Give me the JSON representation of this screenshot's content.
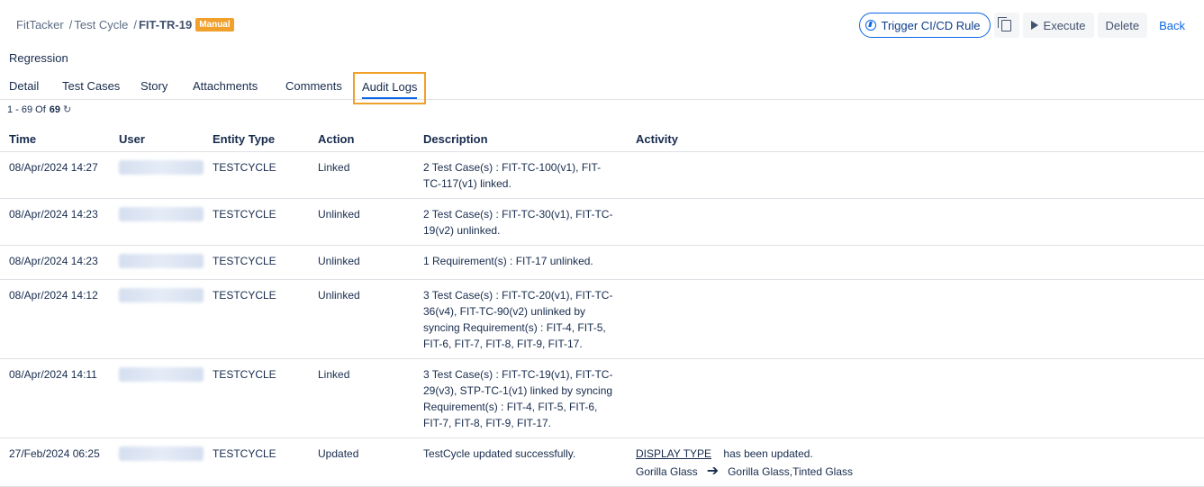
{
  "breadcrumb": {
    "project": "FitTacker",
    "section": "Test Cycle",
    "current": "FIT-TR-19",
    "badge": "Manual"
  },
  "actions": {
    "trigger_label": "Trigger CI/CD Rule",
    "execute_label": "Execute",
    "delete_label": "Delete",
    "back_label": "Back"
  },
  "subtitle": "Regression",
  "tabs": [
    {
      "label": "Detail"
    },
    {
      "label": "Test Cases"
    },
    {
      "label": "Story"
    },
    {
      "label": "Attachments"
    },
    {
      "label": "Comments"
    },
    {
      "label": "Audit Logs",
      "active": true
    }
  ],
  "pager": {
    "range": "1 - 69 Of",
    "total": "69"
  },
  "columns": {
    "time": "Time",
    "user": "User",
    "entity": "Entity Type",
    "action": "Action",
    "description": "Description",
    "activity": "Activity"
  },
  "rows": [
    {
      "time": "08/Apr/2024 14:27",
      "entity": "TESTCYCLE",
      "action": "Linked",
      "description": "2 Test Case(s) : FIT-TC-100(v1), FIT-TC-117(v1) linked."
    },
    {
      "time": "08/Apr/2024 14:23",
      "entity": "TESTCYCLE",
      "action": "Unlinked",
      "description": "2 Test Case(s) : FIT-TC-30(v1), FIT-TC-19(v2) unlinked."
    },
    {
      "time": "08/Apr/2024 14:23",
      "entity": "TESTCYCLE",
      "action": "Unlinked",
      "description": "1 Requirement(s) : FIT-17 unlinked."
    },
    {
      "time": "08/Apr/2024 14:12",
      "entity": "TESTCYCLE",
      "action": "Unlinked",
      "description": "3 Test Case(s) : FIT-TC-20(v1), FIT-TC-36(v4), FIT-TC-90(v2) unlinked by syncing Requirement(s) : FIT-4, FIT-5, FIT-6, FIT-7, FIT-8, FIT-9, FIT-17."
    },
    {
      "time": "08/Apr/2024 14:11",
      "entity": "TESTCYCLE",
      "action": "Linked",
      "description": "3 Test Case(s) : FIT-TC-19(v1), FIT-TC-29(v3), STP-TC-1(v1) linked by syncing Requirement(s) : FIT-4, FIT-5, FIT-6, FIT-7, FIT-8, FIT-9, FIT-17."
    },
    {
      "time": "27/Feb/2024 06:25",
      "entity": "TESTCYCLE",
      "action": "Updated",
      "description": "TestCycle updated successfully.",
      "activity": {
        "field": "DISPLAY TYPE",
        "message": "has been updated.",
        "from": "Gorilla Glass",
        "to": "Gorilla Glass,Tinted Glass"
      }
    }
  ]
}
